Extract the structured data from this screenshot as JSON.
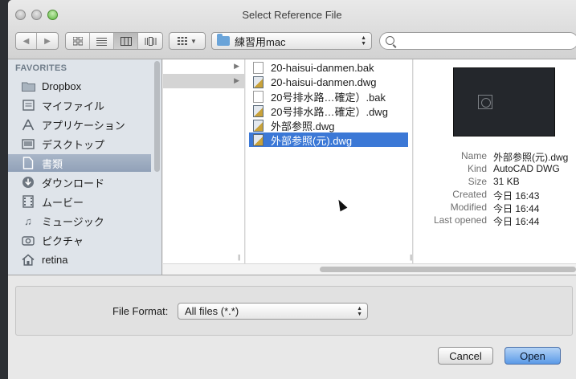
{
  "window": {
    "title": "Select Reference File"
  },
  "toolbar": {
    "back_icon": "back-arrow-icon",
    "forward_icon": "forward-arrow-icon",
    "view_modes": [
      "icon-view",
      "list-view",
      "column-view",
      "cover-flow-view"
    ],
    "path": "練習用mac",
    "search": {
      "value": "",
      "placeholder": ""
    }
  },
  "sidebar": {
    "heading": "FAVORITES",
    "items": [
      {
        "label": "Dropbox",
        "icon": "folder-icon"
      },
      {
        "label": "マイファイル",
        "icon": "my-files-icon"
      },
      {
        "label": "アプリケーション",
        "icon": "applications-icon"
      },
      {
        "label": "デスクトップ",
        "icon": "desktop-icon"
      },
      {
        "label": "書類",
        "icon": "documents-icon",
        "selected": true
      },
      {
        "label": "ダウンロード",
        "icon": "downloads-icon"
      },
      {
        "label": "ムービー",
        "icon": "movies-icon"
      },
      {
        "label": "ミュージック",
        "icon": "music-icon"
      },
      {
        "label": "ピクチャ",
        "icon": "pictures-icon"
      },
      {
        "label": "retina",
        "icon": "home-icon"
      }
    ]
  },
  "files": [
    {
      "name": "20-haisui-danmen.bak",
      "type": "bak"
    },
    {
      "name": "20-haisui-danmen.dwg",
      "type": "dwg"
    },
    {
      "name": "20号排水路…確定）.bak",
      "type": "bak"
    },
    {
      "name": "20号排水路…確定）.dwg",
      "type": "dwg"
    },
    {
      "name": "外部参照.dwg",
      "type": "dwg"
    },
    {
      "name": "外部参照(元).dwg",
      "type": "dwg",
      "selected": true
    }
  ],
  "preview": {
    "rows": [
      {
        "key": "Name",
        "value": "外部参照(元).dwg"
      },
      {
        "key": "Kind",
        "value": "AutoCAD DWG"
      },
      {
        "key": "Size",
        "value": "31 KB"
      },
      {
        "key": "Created",
        "value": "今日 16:43"
      },
      {
        "key": "Modified",
        "value": "今日 16:44"
      },
      {
        "key": "Last opened",
        "value": "今日 16:44"
      }
    ]
  },
  "file_format": {
    "label": "File Format:",
    "value": "All files (*.*)"
  },
  "buttons": {
    "cancel": "Cancel",
    "open": "Open"
  },
  "colors": {
    "selection": "#3b78d6",
    "sidebar_bg": "#dfe4ea",
    "default_button": "#5b9ae7"
  }
}
